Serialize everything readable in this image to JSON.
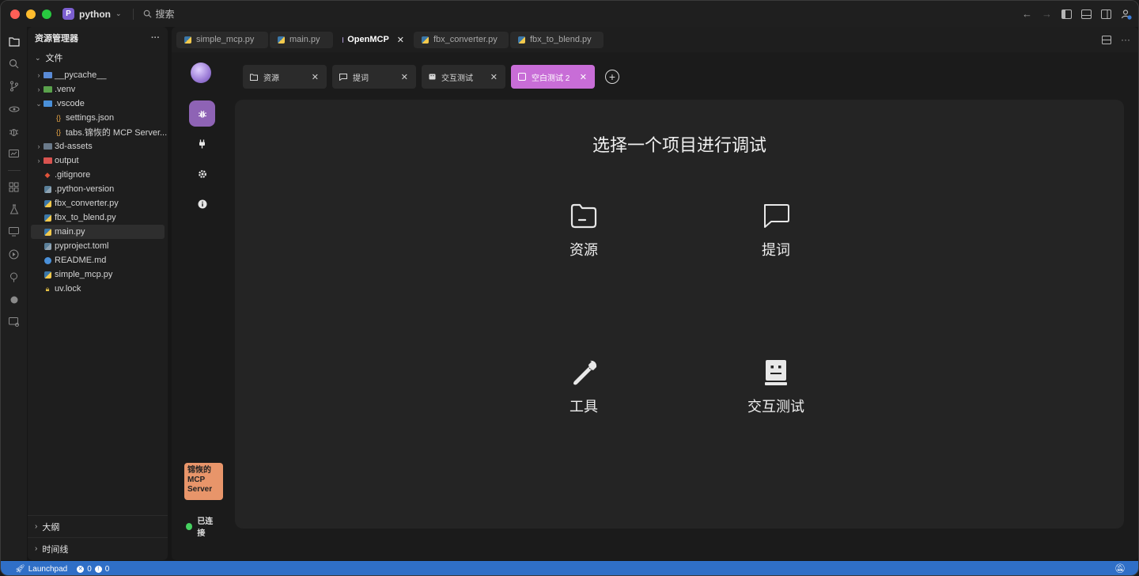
{
  "titlebar": {
    "project_badge": "P",
    "project_name": "python",
    "search_label": "搜索"
  },
  "explorer": {
    "title": "资源管理器",
    "section_files": "文件",
    "items": [
      {
        "label": "__pycache__",
        "type": "folder",
        "color": "#5a8bd6"
      },
      {
        "label": ".venv",
        "type": "folder",
        "color": "#5aa24c"
      },
      {
        "label": ".vscode",
        "type": "folder",
        "color": "#4a90d9"
      },
      {
        "label": "settings.json",
        "type": "json"
      },
      {
        "label": "tabs.锦恢的 MCP Server...",
        "type": "json"
      },
      {
        "label": "3d-assets",
        "type": "folder",
        "color": "#6a7a8a"
      },
      {
        "label": "output",
        "type": "folder",
        "color": "#d9534f"
      },
      {
        "label": ".gitignore",
        "type": "git"
      },
      {
        "label": ".python-version",
        "type": "python"
      },
      {
        "label": "fbx_converter.py",
        "type": "python"
      },
      {
        "label": "fbx_to_blend.py",
        "type": "python"
      },
      {
        "label": "main.py",
        "type": "python"
      },
      {
        "label": "pyproject.toml",
        "type": "toml"
      },
      {
        "label": "README.md",
        "type": "info"
      },
      {
        "label": "simple_mcp.py",
        "type": "python"
      },
      {
        "label": "uv.lock",
        "type": "lock"
      }
    ],
    "section_outline": "大纲",
    "section_timeline": "时间线"
  },
  "editor_tabs": [
    {
      "label": "simple_mcp.py"
    },
    {
      "label": "main.py"
    },
    {
      "label": "OpenMCP"
    },
    {
      "label": "fbx_converter.py"
    },
    {
      "label": "fbx_to_blend.py"
    }
  ],
  "openmcp": {
    "tabs": [
      {
        "label": "资源"
      },
      {
        "label": "提词"
      },
      {
        "label": "交互测试"
      },
      {
        "label": "空白测试 2"
      }
    ],
    "server_name": "锦恢的 MCP Server",
    "connection_status": "已连接",
    "heading": "选择一个项目进行调试",
    "options": {
      "resources": "资源",
      "prompts": "提词",
      "tools": "工具",
      "interactive": "交互测试"
    }
  },
  "statusbar": {
    "launchpad": "Launchpad",
    "errors": "0",
    "warnings": "0"
  },
  "colors": {
    "accent_tab": "#c86dd7",
    "active_side": "#8e63b5",
    "server_badge": "#e8956a",
    "connected": "#46d160",
    "statusbar": "#2f6fc7"
  }
}
